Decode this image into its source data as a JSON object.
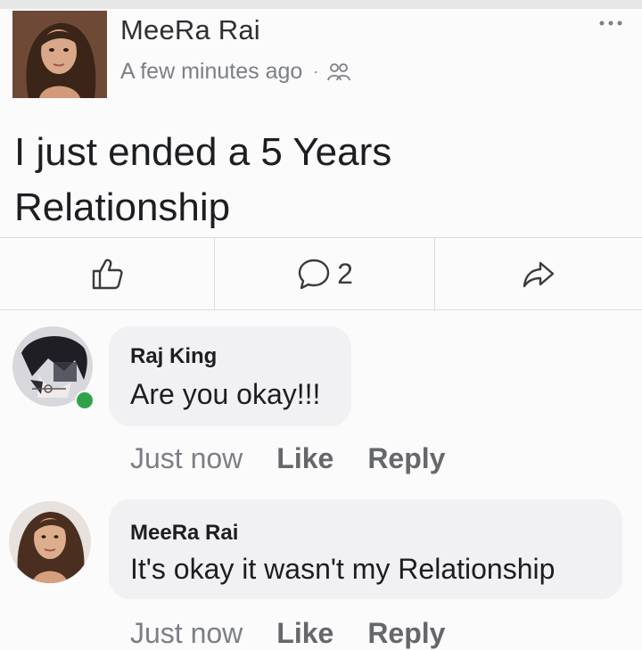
{
  "post": {
    "author": "MeeRa Rai",
    "time": "A few minutes ago",
    "separator": "·",
    "privacy_icon": "friends-icon",
    "text": "I just ended a 5 Years Relationship",
    "comment_count": "2"
  },
  "comments": [
    {
      "name": "Raj King",
      "text": "Are you okay!!!",
      "time": "Just now",
      "like_label": "Like",
      "reply_label": "Reply",
      "online": true
    },
    {
      "name": "MeeRa Rai",
      "text": "It's okay it wasn't my Relationship",
      "time": "Just now",
      "like_label": "Like",
      "reply_label": "Reply"
    }
  ],
  "icons": {
    "like": "thumbs-up-icon",
    "comment": "comment-icon",
    "share": "share-icon",
    "more": "more-dots-icon"
  },
  "colors": {
    "online": "#31a24c",
    "bubble": "#f1f0f2",
    "secondary_text": "#65676b"
  }
}
